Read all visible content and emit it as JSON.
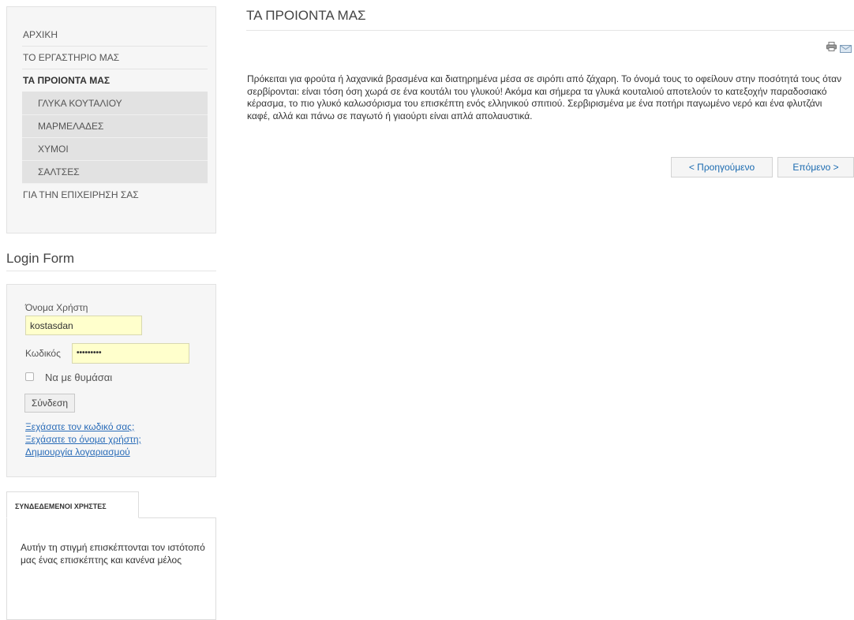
{
  "sidebar": {
    "menu": {
      "items": [
        {
          "label": "ΑΡΧΙΚΗ"
        },
        {
          "label": "ΤΟ ΕΡΓΑΣΤΗΡΙΟ ΜΑΣ"
        },
        {
          "label": "ΤΑ ΠΡΟΙΟΝΤΑ ΜΑΣ",
          "active": true,
          "children": [
            {
              "label": "ΓΛΥΚΑ ΚΟΥΤΑΛΙΟΥ"
            },
            {
              "label": "ΜΑΡΜΕΛΑΔΕΣ"
            },
            {
              "label": "ΧΥΜΟΙ"
            },
            {
              "label": "ΣΑΛΤΣΕΣ"
            }
          ]
        },
        {
          "label": "ΓΙΑ ΤΗΝ ΕΠΙΧΕΙΡΗΣΗ ΣΑΣ"
        }
      ]
    },
    "login": {
      "title": "Login Form",
      "username_label": "Όνομα Χρήστη",
      "username_value": "kostasdan",
      "password_label": "Κωδικός",
      "password_value": "•••••••••",
      "remember_label": "Να με θυμάσαι",
      "remember_checked": false,
      "submit_label": "Σύνδεση",
      "links": {
        "forgot_password": "Ξεχάσατε τον κωδικό σας;",
        "forgot_username": "Ξεχάσατε το όνομα χρήστη;",
        "create_account": "Δημιουργία λογαριασμού"
      }
    },
    "online_users": {
      "tab_label": "ΣΥΝΔΕΔΕΜΕΝΟΙ ΧΡΗΣΤΕΣ",
      "text": "Αυτήν τη στιγμή επισκέπτονται τον ιστότοπό μας ένας επισκέπτης και κανένα μέλος"
    }
  },
  "main": {
    "title": "ΤΑ ΠΡΟΙΟΝΤΑ ΜΑΣ",
    "icons": [
      "print-icon",
      "email-icon"
    ],
    "article": "Πρόκειται για φρούτα ή λαχανικά βρασμένα και διατηρημένα μέσα σε σιρόπι από ζάχαρη. Το όνομά τους το οφείλουν στην ποσότητά τους όταν σερβίρονται: είναι τόση όση χωρά σε ένα κουτάλι του γλυκού! Ακόμα και σήμερα τα γλυκά κουταλιού αποτελούν το κατεξοχήν παραδοσιακό κέρασμα, το πιο γλυκό καλωσόρισμα του επισκέπτη ενός ελληνικού σπιτιού. Σερβιρισμένα με ένα ποτήρι παγωμένο νερό και ένα φλυτζάνι καφέ, αλλά και πάνω σε παγωτό ή γιαούρτι είναι απλά απολαυστικά.",
    "pager": {
      "prev_label": "< Προηγούμενο",
      "next_label": "Επόμενο >"
    }
  },
  "colors": {
    "link": "#2a6cb8",
    "input_bg": "#ffffcc",
    "panel_bg": "#f6f6f6",
    "submenu_bg": "#e2e2e2"
  }
}
